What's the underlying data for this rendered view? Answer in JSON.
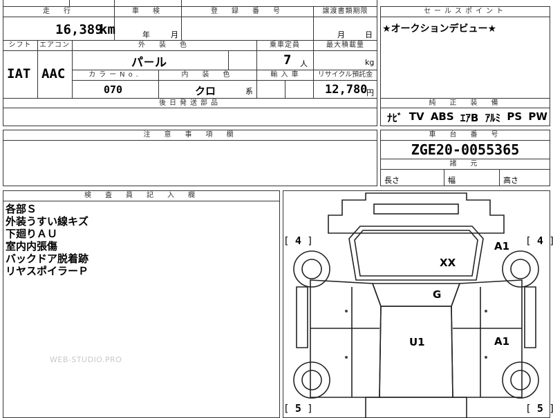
{
  "headers": {
    "mileage": "走　行",
    "inspection": "車　検",
    "registration": "登　録　番　号",
    "transfer_docs": "譲渡書類期限",
    "sales_point": "セールスポイント",
    "shift": "シフト",
    "aircon": "エアコン",
    "exterior_color": "外　装　色",
    "capacity": "乗車定員",
    "max_load": "最大積載量",
    "color_no": "カラーNo.",
    "interior_color": "内　装　色",
    "import": "輸 入 車",
    "recycle": "リサイクル預託金",
    "deferred_parts": "後日発送部品",
    "standard_equipment": "純　正　装　備",
    "notes": "注　意　事　項　欄",
    "chassis_no": "車　台　番　号",
    "specs": "諸　元",
    "inspector": "検　査　員　記　入　欄"
  },
  "values": {
    "mileage": "16,389",
    "mileage_unit": "km",
    "inspection_year_unit": "年",
    "inspection_month_unit": "月",
    "transfer_month_unit": "月",
    "transfer_day_unit": "日",
    "shift": "IAT",
    "aircon": "AAC",
    "exterior_color": "パ－ル",
    "capacity": "7",
    "capacity_unit": "人",
    "max_load_unit": "kg",
    "color_no": "070",
    "interior_color": "クロ",
    "interior_color_suffix": "系",
    "recycle": "12,780",
    "recycle_unit": "円",
    "sales_point": "★オークションデビュー★",
    "equipment": [
      "ﾅﾋﾞ",
      "TV",
      "ABS",
      "ｴｱB",
      "ｱﾙﾐ",
      "PS",
      "PW"
    ],
    "chassis_no": "ZGE20-0055365",
    "spec_length": "長さ",
    "spec_width": "幅",
    "spec_height": "高さ"
  },
  "inspector_remarks": [
    "各部Ｓ",
    "外装うすい線キズ",
    "下廻りＡＵ",
    "室内内張傷",
    "バックドア脱着跡",
    "リヤスポイラーＰ"
  ],
  "watermark": "WEB-STUDIO.PRO",
  "diagram": {
    "tire_front_left": "4",
    "tire_front_right": "4",
    "tire_rear_left": "5",
    "tire_rear_right": "5",
    "marks": {
      "hood": "XX",
      "front_right": "A1",
      "windshield": "G",
      "roof": "U1",
      "side_right": "A1"
    }
  }
}
